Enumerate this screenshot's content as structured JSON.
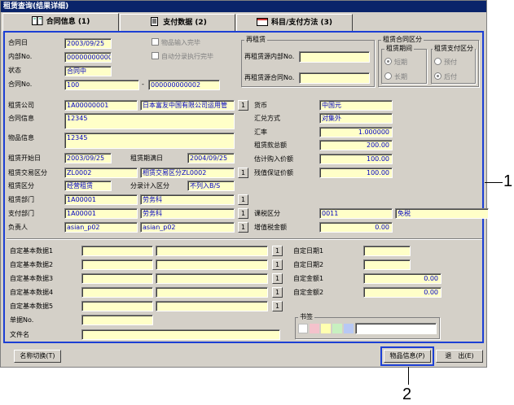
{
  "window": {
    "title": "租赁查询(结果详细)"
  },
  "tabs": [
    {
      "label": "合同信息 (1)"
    },
    {
      "label": "支付数据 (2)"
    },
    {
      "label": "科目/支付方法 (3)"
    }
  ],
  "contract": {
    "date_label": "合同日",
    "date_value": "2003/09/25",
    "internal_label": "内部No.",
    "internal_value": "000000000002",
    "status_label": "状态",
    "status_value": "合同中",
    "contract_no_label": "合同No.",
    "contract_no_value": "100",
    "contract_no_sep": "-",
    "contract_no_suffix": "000000000002",
    "chk_goods": "物品输入完毕",
    "chk_auto": "自动分录执行完毕"
  },
  "relinquish": {
    "title": "再租赁",
    "src_internal_label": "再租赁源内部No.",
    "src_contract_label": "再租赁源合同No."
  },
  "lease_class": {
    "title": "租赁合同区分",
    "period_title": "租赁期间",
    "period_short": "短期",
    "period_long": "长期",
    "pay_title": "租赁支付区分",
    "pay_advance": "预付",
    "pay_later": "后付"
  },
  "left": {
    "company_label": "租赁公司",
    "company_code": "1A00000001",
    "company_name": "日本富友中国有限公司运用管",
    "contract_info_label": "合同信息",
    "contract_info_value": "12345",
    "goods_info_label": "物品信息",
    "goods_info_value": "12345",
    "start_label": "租赁开始日",
    "start_value": "2003/09/25",
    "end_label": "租赁期满日",
    "end_value": "2004/09/25",
    "trade_label": "租赁交易区分",
    "trade_code": "ZL0002",
    "trade_name": "相赁交易区分ZL0002",
    "lease_kind_label": "租赁区分",
    "lease_kind_value": "经营租赁",
    "split_label": "分录计入区分",
    "split_value": "不列入B/S",
    "dept_label": "租赁部门",
    "dept_code": "1A00001",
    "dept_name": "劳务科",
    "pay_dept_label": "支付部门",
    "pay_dept_code": "1A00001",
    "pay_dept_name": "劳务科",
    "person_label": "负责人",
    "person_code": "asian_p02",
    "person_name": "asian_p02"
  },
  "right": {
    "currency_label": "货币",
    "currency_value": "中国元",
    "convert_label": "汇兑方式",
    "convert_value": "对集外",
    "rate_label": "汇率",
    "rate_value": "1.000000",
    "total_label": "租赁款总额",
    "total_value": "200.00",
    "estimate_label": "估计购入价额",
    "estimate_value": "100.00",
    "residual_label": "残值保证价额",
    "residual_value": "100.00",
    "tax_class_label": "课税区分",
    "tax_class_code": "0011",
    "tax_class_name": "免税",
    "vat_label": "增值税金额",
    "vat_value": "0.00"
  },
  "custom": {
    "data1": "自定基本数据1",
    "data2": "自定基本数据2",
    "data3": "自定基本数据3",
    "data4": "自定基本数据4",
    "data5": "自定基本数据5",
    "slip_label": "单据No.",
    "file_label": "文件名",
    "date1": "自定日期1",
    "date2": "自定日期2",
    "amount1": "自定金额1",
    "amount1_value": "0.00",
    "amount2": "自定金额2",
    "amount2_value": "0.00",
    "bookmark": "书签"
  },
  "buttons": {
    "name_switch": "名称切换(T)",
    "goods_info": "物品信息(P)",
    "exit": "退　出(E)",
    "pick": "1"
  },
  "callouts": {
    "one": "1",
    "two": "2"
  },
  "colors": {
    "panel_border": "#1c3fd4",
    "field_bg": "#ffffc8",
    "title_bg": "#0a246a"
  }
}
